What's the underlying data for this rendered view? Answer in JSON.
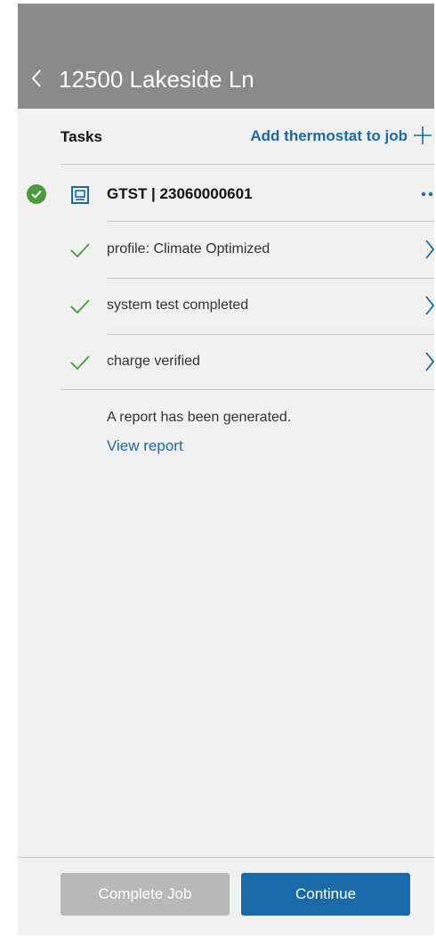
{
  "header": {
    "title": "12500 Lakeside Ln",
    "back_icon": "chevron-left-icon"
  },
  "tasks_section": {
    "label": "Tasks",
    "add_link": "Add thermostat to job",
    "add_icon": "plus-icon"
  },
  "device": {
    "title": "GTST | 23060000601",
    "status_icon": "check-circle-icon",
    "device_icon": "thermostat-icon",
    "more_icon": "ellipsis-icon"
  },
  "tasks": [
    {
      "label": "profile: Climate Optimized",
      "icon": "check-icon",
      "chevron": "chevron-right-icon"
    },
    {
      "label": "system test completed",
      "icon": "check-icon",
      "chevron": "chevron-right-icon"
    },
    {
      "label": "charge verified",
      "icon": "check-icon",
      "chevron": "chevron-right-icon"
    }
  ],
  "report": {
    "text": "A report has been generated.",
    "link": "View report"
  },
  "buttons": {
    "complete": "Complete Job",
    "continue": "Continue"
  },
  "colors": {
    "accent": "#1a6aa8",
    "success": "#4a9a3c",
    "header": "#8a8a8a",
    "disabled": "#b8b8b8"
  }
}
